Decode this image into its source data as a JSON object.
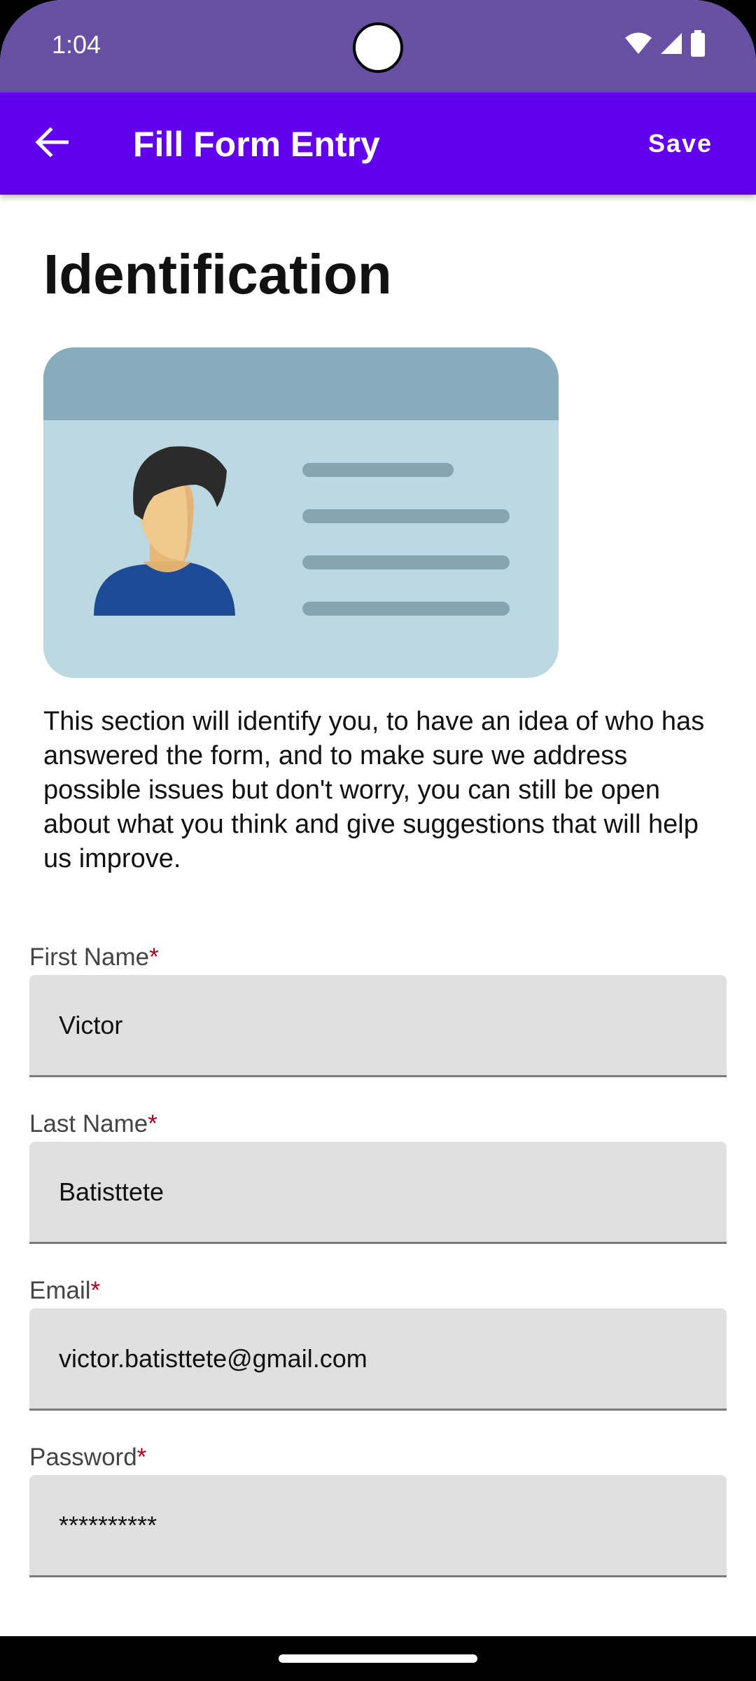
{
  "status_bar": {
    "time": "1:04"
  },
  "app_bar": {
    "title": "Fill Form Entry",
    "save_label": "Save"
  },
  "section": {
    "title": "Identification",
    "description": "This section will identify you, to have an idea of who has answered the form, and to make sure we address possible issues but don't worry, you can still be open about what you think and give suggestions that will help us improve."
  },
  "fields": [
    {
      "label": "First Name",
      "required_mark": "*",
      "value": "Victor"
    },
    {
      "label": "Last Name",
      "required_mark": "*",
      "value": "Batisttete"
    },
    {
      "label": "Email",
      "required_mark": "*",
      "value": "victor.batisttete@gmail.com"
    },
    {
      "label": "Password",
      "required_mark": "*",
      "value": "**********"
    }
  ],
  "colors": {
    "status_bar": "#6750a4",
    "app_bar": "#6200ee",
    "required": "#b00020",
    "input_bg": "#e0e0e0"
  },
  "icons": [
    "back-arrow-icon",
    "wifi-icon",
    "cellular-signal-icon",
    "battery-icon",
    "id-card-illustration"
  ]
}
